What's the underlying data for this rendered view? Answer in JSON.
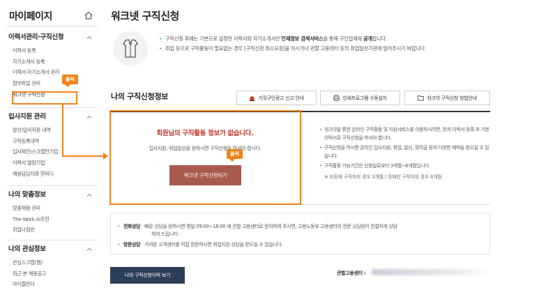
{
  "sidebar": {
    "title": "마이페이지",
    "groups": [
      {
        "title": "이력서관리·구직신청",
        "items": [
          "이력서 등록",
          "자기소개서 등록",
          "이력서·자기소개서 관리",
          "첨부파일 관리",
          "워크넷 구직신청"
        ]
      },
      {
        "title": "입사지원 관리",
        "items": [
          "알선/입사지원 내역",
          "구직등록내역",
          "입사제안/스크랩한기업",
          "이력서 열람기업",
          "채용담당자와 한마디"
        ]
      },
      {
        "title": "나의 맞춤정보",
        "items": [
          "맞춤채용 관리",
          "The Work AI추천",
          "취업나침반"
        ]
      },
      {
        "title": "나의 관심정보",
        "items": [
          "관심스크랩(찜)",
          "최근 본 채용공고",
          "마이캘린더"
        ]
      }
    ]
  },
  "annotations": {
    "click_label_1": "클릭",
    "click_label_2": "클릭"
  },
  "main": {
    "title": "워크넷 구직신청",
    "info": {
      "line1_pre": "구직신청 후에는 기본으로 설정한 이력서와 자기소개서만 ",
      "line1_bold1": "인재정보 검색서비스",
      "line1_mid": "를 통해 구인업체에 ",
      "line1_bold2": "공개",
      "line1_post": "합니다.",
      "line2": "취업 등으로 구직활동이 필요없는 경우 [구직신청 취소요청]을 하시거나 관할 고용센터 등의 취업알선기관에 알려주시기 바랍니다."
    },
    "section_title": "나의 구직신청정보",
    "tools": {
      "report": "거짓구인광고 신고 안내",
      "print": "인쇄프로그램 수동설치",
      "guide": "워크넷 구직신청 방법안내"
    },
    "status": {
      "heading": "회원님의 구직활동 정보가 없습니다.",
      "desc": "입사지원, 취업알선을 원하시면 구직신청을 하셔야 합니다.",
      "apply_button": "워크넷 구직신청하기",
      "notes": [
        "워크넷을 통한 온라인 구직활동 및 지원서비스를 이용하시려면, 먼저 이력서 등록 후 기본이력서로 구직신청을 하셔야 합니다.",
        "구직신청을 하시면 온라인 입사지원, 취업, 알선, 장려금 등의 다양한 혜택을 받으실 수 있습니다.",
        "구직활동 가능기간은 신청일로부터 3개월~6개월입니다."
      ],
      "sub_note": "※ 비장애 구직자의 경우 3개월 / 장애인 구직자의 경우 6개월"
    },
    "contact": {
      "phone_label": "전화상담",
      "phone_text_1": "빠른 상담을 원하시면 평일 09:00~18:00 에 관할 고용센터로 문의하여 주시면, 고용노동부 고용센터의 전문 상담원이 친절하게 상담",
      "phone_text_2": "하여 드립니다.",
      "visit_label": "방문상담",
      "visit_text": "가까운 고객센터를 직접 방문하시면 취업지원 상담을 받으실 수 있습니다."
    },
    "history_button": "나의 구직신청이력 보기",
    "office_label": "관할고용센터 :"
  }
}
